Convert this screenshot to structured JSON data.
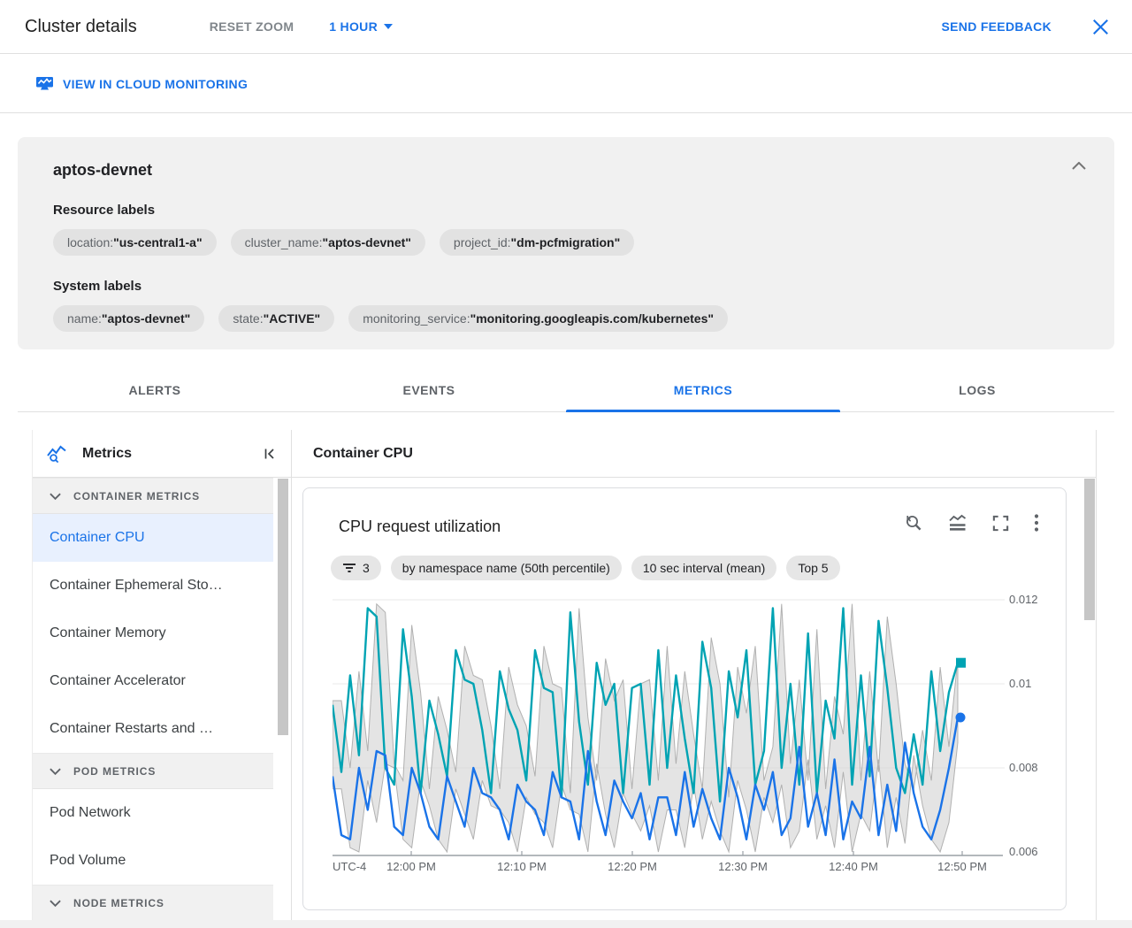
{
  "header": {
    "title": "Cluster details",
    "reset_zoom_label": "RESET ZOOM",
    "time_range_label": "1 HOUR",
    "send_feedback_label": "SEND FEEDBACK"
  },
  "link_bar": {
    "view_in_monitoring_label": "VIEW IN CLOUD MONITORING"
  },
  "summary": {
    "title": "aptos-devnet",
    "resource_labels_title": "Resource labels",
    "system_labels_title": "System labels",
    "sep": " : ",
    "resource_labels": [
      {
        "key": "location",
        "value": "\"us-central1-a\""
      },
      {
        "key": "cluster_name",
        "value": "\"aptos-devnet\""
      },
      {
        "key": "project_id",
        "value": "\"dm-pcfmigration\""
      }
    ],
    "system_labels": [
      {
        "key": "name",
        "value": "\"aptos-devnet\""
      },
      {
        "key": "state",
        "value": "\"ACTIVE\""
      },
      {
        "key": "monitoring_service",
        "value": "\"monitoring.googleapis.com/kubernetes\""
      }
    ]
  },
  "tabs": [
    {
      "label": "ALERTS",
      "active": false
    },
    {
      "label": "EVENTS",
      "active": false
    },
    {
      "label": "METRICS",
      "active": true
    },
    {
      "label": "LOGS",
      "active": false
    }
  ],
  "sidebar": {
    "title": "Metrics",
    "sections": [
      {
        "label": "CONTAINER METRICS",
        "items": [
          {
            "label": "Container CPU",
            "selected": true
          },
          {
            "label": "Container Ephemeral Sto…",
            "selected": false
          },
          {
            "label": "Container Memory",
            "selected": false
          },
          {
            "label": "Container Accelerator",
            "selected": false
          },
          {
            "label": "Container Restarts and …",
            "selected": false
          }
        ]
      },
      {
        "label": "POD METRICS",
        "items": [
          {
            "label": "Pod Network",
            "selected": false
          },
          {
            "label": "Pod Volume",
            "selected": false
          }
        ]
      },
      {
        "label": "NODE METRICS",
        "items": []
      }
    ]
  },
  "main": {
    "header": "Container CPU"
  },
  "chart": {
    "title": "CPU request utilization",
    "chips": [
      {
        "icon": "filter-list-icon",
        "label": "3"
      },
      {
        "label": "by namespace name (50th percentile)"
      },
      {
        "label": "10 sec interval (mean)"
      },
      {
        "label": "Top 5"
      }
    ]
  },
  "colors": {
    "accent": "#1a73e8",
    "series_teal": "#00a3b3",
    "series_blue": "#1a73e8",
    "band_fill": "#d8d8d8",
    "band_stroke": "#a0a0a0",
    "selected_item_bg": "#e8f0fe"
  },
  "icon_names": [
    "monitoring-icon",
    "metrics-icon",
    "collapse-panel-icon",
    "chevron-down-icon",
    "chevron-up-icon",
    "caret-down-icon",
    "close-icon",
    "zoom-reset-icon",
    "area-chart-icon",
    "fullscreen-icon",
    "more-vert-icon",
    "filter-list-icon"
  ],
  "chart_data": {
    "type": "line",
    "title": "CPU request utilization",
    "x_axis": {
      "timezone": "UTC-4",
      "ticks": [
        "12:00 PM",
        "12:10 PM",
        "12:20 PM",
        "12:30 PM",
        "12:40 PM",
        "12:50 PM"
      ]
    },
    "y_axis": {
      "ticks": [
        0.012,
        0.01,
        0.008,
        0.006
      ],
      "range": [
        0.006,
        0.0125
      ],
      "grid": true
    },
    "legend": "none",
    "series": [
      {
        "name": "series-teal",
        "color": "#00a3b3",
        "marker": "square",
        "values": [
          0.0095,
          0.0079,
          0.0102,
          0.0083,
          0.0118,
          0.0116,
          0.008,
          0.0076,
          0.0113,
          0.0097,
          0.0074,
          0.0096,
          0.0088,
          0.0078,
          0.0108,
          0.0101,
          0.01,
          0.0089,
          0.0074,
          0.0103,
          0.0094,
          0.0089,
          0.0077,
          0.0108,
          0.0099,
          0.0098,
          0.0073,
          0.0117,
          0.0091,
          0.0076,
          0.0105,
          0.0095,
          0.01,
          0.0074,
          0.0099,
          0.01,
          0.0076,
          0.0108,
          0.008,
          0.0102,
          0.0087,
          0.0074,
          0.011,
          0.0099,
          0.0072,
          0.0103,
          0.0092,
          0.0108,
          0.0076,
          0.0084,
          0.0118,
          0.008,
          0.01,
          0.0076,
          0.0112,
          0.0074,
          0.0096,
          0.0087,
          0.0118,
          0.0076,
          0.0102,
          0.0078,
          0.0115,
          0.0099,
          0.008,
          0.0074,
          0.0088,
          0.0076,
          0.0103,
          0.0084,
          0.0098,
          0.0105
        ]
      },
      {
        "name": "series-blue",
        "color": "#1a73e8",
        "marker": "circle",
        "values": [
          0.0078,
          0.0064,
          0.0063,
          0.008,
          0.007,
          0.0084,
          0.0083,
          0.0066,
          0.0064,
          0.008,
          0.0074,
          0.0066,
          0.0063,
          0.0078,
          0.0072,
          0.0066,
          0.008,
          0.0074,
          0.0073,
          0.007,
          0.0063,
          0.0076,
          0.0072,
          0.007,
          0.0064,
          0.0079,
          0.0073,
          0.0072,
          0.0063,
          0.0084,
          0.0072,
          0.0064,
          0.0077,
          0.0072,
          0.0068,
          0.0074,
          0.0063,
          0.0073,
          0.0073,
          0.0064,
          0.0079,
          0.0066,
          0.0075,
          0.0068,
          0.0063,
          0.008,
          0.0073,
          0.0063,
          0.0076,
          0.007,
          0.0079,
          0.0064,
          0.0068,
          0.0085,
          0.0066,
          0.0074,
          0.0064,
          0.0082,
          0.0063,
          0.0072,
          0.0068,
          0.0085,
          0.0064,
          0.0076,
          0.0065,
          0.0086,
          0.0074,
          0.0066,
          0.0063,
          0.007,
          0.008,
          0.0092
        ]
      }
    ],
    "band": {
      "fill": "#d8d8d8",
      "stroke": "#a0a0a0",
      "upper": [
        0.0096,
        0.0096,
        0.008,
        0.0103,
        0.0084,
        0.0119,
        0.0117,
        0.0081,
        0.0077,
        0.0114,
        0.0098,
        0.0075,
        0.0097,
        0.0089,
        0.0079,
        0.0109,
        0.0102,
        0.0101,
        0.009,
        0.0075,
        0.0104,
        0.0095,
        0.009,
        0.0078,
        0.0109,
        0.01,
        0.0099,
        0.0074,
        0.0118,
        0.0092,
        0.0077,
        0.0106,
        0.0096,
        0.0101,
        0.0075,
        0.01,
        0.0101,
        0.0077,
        0.0109,
        0.0081,
        0.0103,
        0.0088,
        0.0075,
        0.0111,
        0.01,
        0.0073,
        0.0104,
        0.0093,
        0.0109,
        0.0077,
        0.0085,
        0.0119,
        0.0081,
        0.0101,
        0.0077,
        0.0113,
        0.0075,
        0.0097,
        0.0088,
        0.0119,
        0.0077,
        0.0103,
        0.0079,
        0.0116,
        0.01,
        0.0081,
        0.0075,
        0.0089,
        0.0077,
        0.0104,
        0.0085,
        0.0106
      ],
      "lower": [
        0.0075,
        0.0075,
        0.0061,
        0.006,
        0.0077,
        0.0067,
        0.0081,
        0.008,
        0.0063,
        0.0061,
        0.0077,
        0.0071,
        0.0063,
        0.006,
        0.0075,
        0.0069,
        0.0063,
        0.0077,
        0.0071,
        0.007,
        0.0067,
        0.006,
        0.0073,
        0.0069,
        0.0067,
        0.0061,
        0.0076,
        0.007,
        0.0069,
        0.006,
        0.0081,
        0.0069,
        0.0061,
        0.0074,
        0.0069,
        0.0065,
        0.0071,
        0.006,
        0.007,
        0.007,
        0.0061,
        0.0076,
        0.0063,
        0.0072,
        0.0065,
        0.006,
        0.0077,
        0.007,
        0.006,
        0.0073,
        0.0067,
        0.0076,
        0.0061,
        0.0065,
        0.0082,
        0.0063,
        0.0071,
        0.0061,
        0.0079,
        0.006,
        0.0069,
        0.0065,
        0.0082,
        0.0061,
        0.0073,
        0.0062,
        0.0083,
        0.0071,
        0.0063,
        0.006,
        0.0067,
        0.0086
      ]
    }
  }
}
